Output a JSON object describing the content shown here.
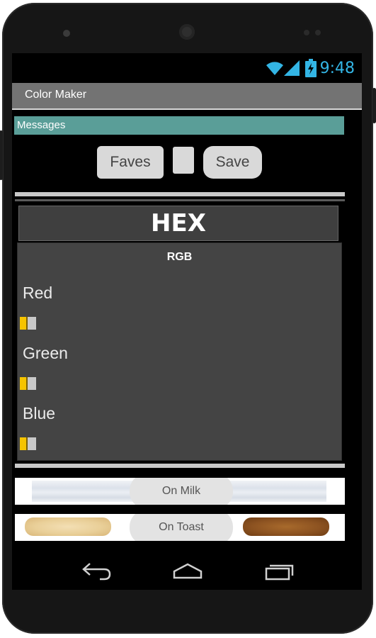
{
  "status_bar": {
    "time": "9:48"
  },
  "app": {
    "title": "Color Maker"
  },
  "messages_label": "Messages",
  "buttons": {
    "faves": "Faves",
    "save": "Save"
  },
  "hex_label": "HEX",
  "rgb_label": "RGB",
  "sliders": [
    {
      "label": "Red",
      "value": 0
    },
    {
      "label": "Green",
      "value": 0
    },
    {
      "label": "Blue",
      "value": 0
    }
  ],
  "previews": {
    "milk": "On Milk",
    "toast": "On Toast"
  },
  "colors": {
    "accent": "#33b5e5",
    "messages_bar": "#5a9e98",
    "slider_thumb": "#f6c400",
    "panel": "#444444"
  }
}
